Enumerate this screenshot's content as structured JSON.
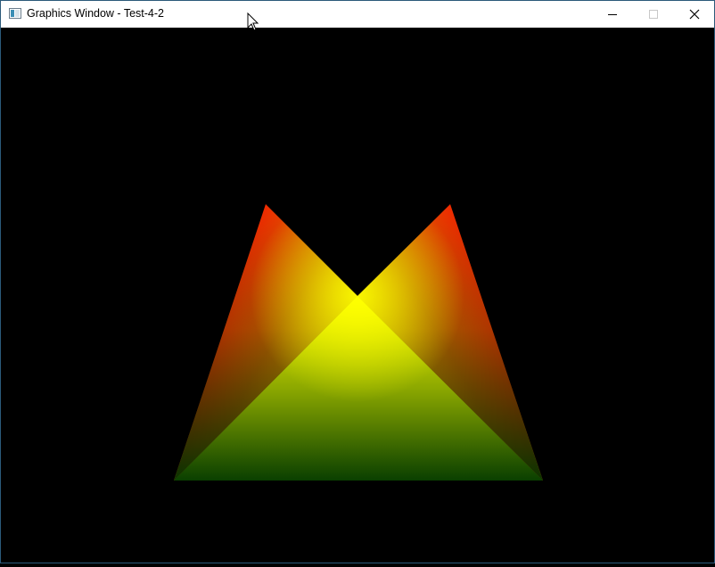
{
  "window": {
    "title": "Graphics Window - Test-4-2",
    "icon": "app-window-icon",
    "controls": {
      "minimize_icon": "minimize-icon",
      "maximize_icon": "maximize-icon",
      "close_icon": "close-icon"
    }
  },
  "scene": {
    "background": "#000000",
    "shape": "M-shaped polygon with per-vertex color gradient",
    "vertex_colors": {
      "top_peaks": "#ff0000",
      "center_notch": "#ffff00",
      "bottom_corners": "#004000"
    }
  },
  "cursor": "arrow-cursor-icon"
}
